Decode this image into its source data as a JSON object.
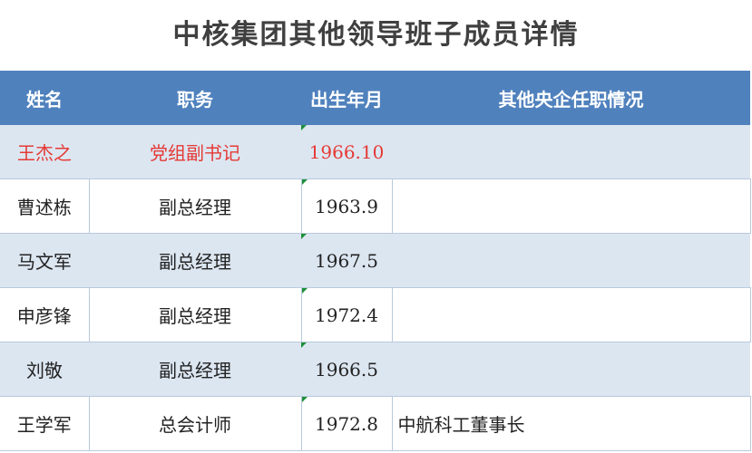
{
  "title": "中核集团其他领导班子成员详情",
  "headers": [
    "姓名",
    "职务",
    "出生年月",
    "其他央企任职情况"
  ],
  "rows": [
    {
      "name": "王杰之",
      "position": "党组副书记",
      "birth": "1966.10",
      "other": ""
    },
    {
      "name": "曹述栋",
      "position": "副总经理",
      "birth": "1963.9",
      "other": ""
    },
    {
      "name": "马文军",
      "position": "副总经理",
      "birth": "1967.5",
      "other": ""
    },
    {
      "name": "申彦锋",
      "position": "副总经理",
      "birth": "1972.4",
      "other": ""
    },
    {
      "name": "刘敬",
      "position": "副总经理",
      "birth": "1966.5",
      "other": ""
    },
    {
      "name": "王学军",
      "position": "总会计师",
      "birth": "1972.8",
      "other": "中航科工董事长"
    }
  ],
  "colors": {
    "header_bg": "#4f81bd",
    "band_bg": "#dce6f1",
    "highlight_text": "#e53935",
    "title_text": "#404040"
  }
}
